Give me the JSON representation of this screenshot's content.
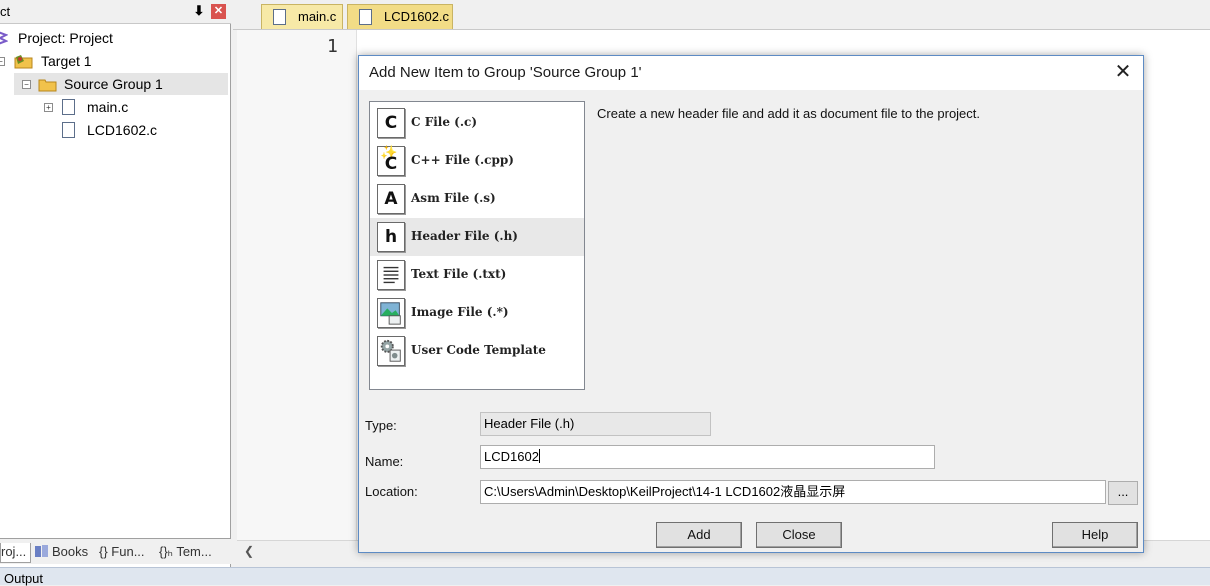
{
  "project_panel": {
    "title": "ct",
    "tree": {
      "project": "Project: Project",
      "target": "Target 1",
      "group": "Source Group 1",
      "files": [
        "main.c",
        "LCD1602.c"
      ]
    },
    "tabs": [
      "roj...",
      "Books",
      "{} Fun...",
      "{}ₕ Tem..."
    ]
  },
  "editor": {
    "tabs": [
      "main.c",
      "LCD1602.c"
    ],
    "active_tab": "LCD1602.c",
    "line_number": "1"
  },
  "output_bar": {
    "label": "Output"
  },
  "dialog": {
    "title": "Add New Item to Group 'Source Group 1'",
    "description": "Create a new header file and add it as document file to the project.",
    "file_types": [
      {
        "icon": "c-file-icon",
        "glyph": "C",
        "label": "C File (.c)"
      },
      {
        "icon": "cpp-file-icon",
        "glyph": "C",
        "label": "C++ File (.cpp)"
      },
      {
        "icon": "asm-file-icon",
        "glyph": "A",
        "label": "Asm File (.s)"
      },
      {
        "icon": "header-file-icon",
        "glyph": "h",
        "label": "Header File (.h)"
      },
      {
        "icon": "text-file-icon",
        "glyph": "",
        "label": "Text File (.txt)"
      },
      {
        "icon": "image-file-icon",
        "glyph": "",
        "label": "Image File (.*)"
      },
      {
        "icon": "user-code-template-icon",
        "glyph": "",
        "label": "User Code Template"
      }
    ],
    "selected_type": "Header File (.h)",
    "type_label": "Type:",
    "type_value": "Header File (.h)",
    "name_label": "Name:",
    "name_value": "LCD1602",
    "location_label": "Location:",
    "location_value": "C:\\Users\\Admin\\Desktop\\KeilProject\\14-1 LCD1602液晶显示屏",
    "browse_label": "...",
    "buttons": {
      "add": "Add",
      "close": "Close",
      "help": "Help"
    }
  },
  "colors": {
    "tab_bg": "#f7e9a7",
    "dialog_border": "#5d8bc4",
    "selection": "#e8e8e8"
  }
}
